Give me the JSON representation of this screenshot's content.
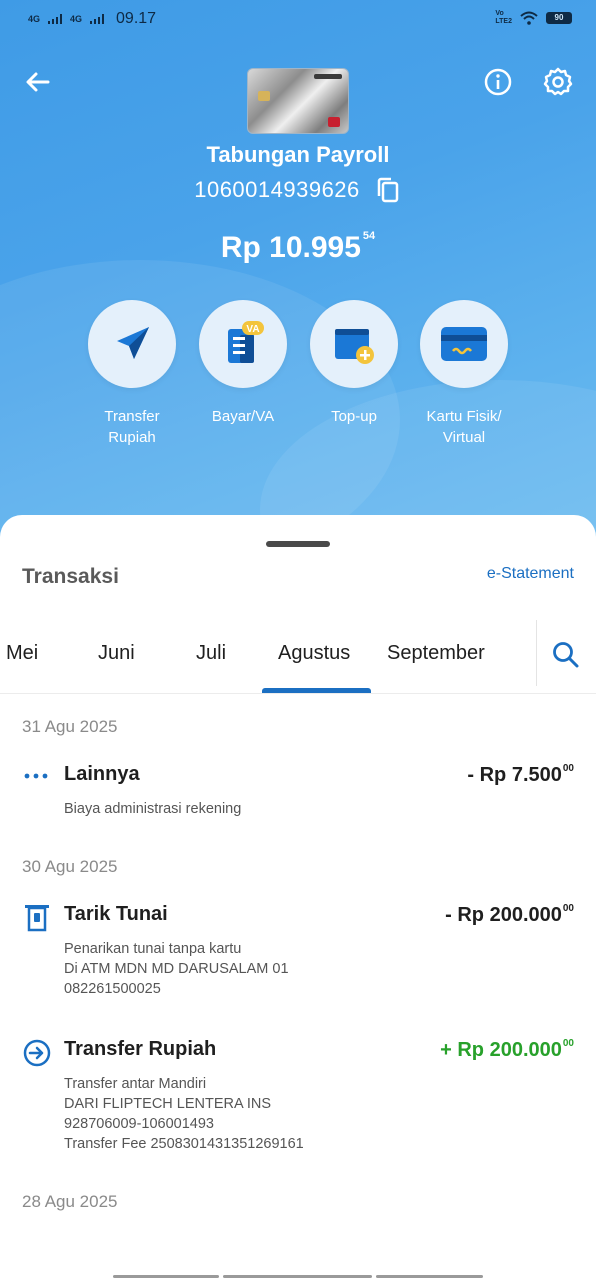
{
  "status_bar": {
    "net1": "4G",
    "net2": "4G",
    "time": "09.17",
    "volte": "Vo\nLTE2",
    "battery": "90"
  },
  "header": {
    "account_name": "Tabungan Payroll",
    "account_number": "1060014939626",
    "balance_main": "Rp 10.995",
    "balance_cents": "54"
  },
  "actions": [
    {
      "label": "Transfer\nRupiah",
      "icon": "send-icon"
    },
    {
      "label": "Bayar/VA",
      "icon": "bill-va-icon"
    },
    {
      "label": "Top-up",
      "icon": "wallet-plus-icon"
    },
    {
      "label": "Kartu Fisik/\nVirtual",
      "icon": "card-icon"
    }
  ],
  "sheet": {
    "title": "Transaksi",
    "estatement": "e-Statement",
    "tabs": [
      "Mei",
      "Juni",
      "Juli",
      "Agustus",
      "September"
    ],
    "active_tab": "Agustus"
  },
  "groups": [
    {
      "date": "31 Agu 2025",
      "items": [
        {
          "icon": "more-dots-icon",
          "title": "Lainnya",
          "amount": "- Rp 7.500",
          "amount_cents": "00",
          "type": "debit",
          "desc": "Biaya administrasi rekening"
        }
      ]
    },
    {
      "date": "30 Agu 2025",
      "items": [
        {
          "icon": "atm-withdraw-icon",
          "title": "Tarik Tunai",
          "amount": "- Rp 200.000",
          "amount_cents": "00",
          "type": "debit",
          "desc": "Penarikan tunai tanpa kartu\nDi ATM MDN MD DARUSALAM 01\n082261500025"
        },
        {
          "icon": "transfer-in-icon",
          "title": "Transfer Rupiah",
          "amount": "+ Rp 200.000",
          "amount_cents": "00",
          "type": "credit",
          "desc": "Transfer antar Mandiri\nDARI FLIPTECH LENTERA INS\n928706009-106001493\nTransfer Fee 2508301431351269161"
        }
      ]
    },
    {
      "date": "28 Agu 2025",
      "items": []
    }
  ],
  "colors": {
    "accent": "#1b6fc2",
    "credit": "#28a12b",
    "hero": "#4aa3ea"
  }
}
